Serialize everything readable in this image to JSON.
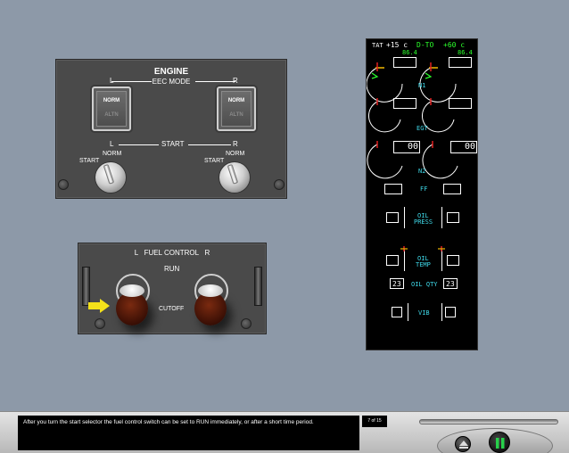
{
  "engine_panel": {
    "title": "ENGINE",
    "eec_mode_label": "EEC MODE",
    "left_label": "L",
    "right_label": "R",
    "eec_left": {
      "norm": "NORM",
      "altn": "ALTN"
    },
    "eec_right": {
      "norm": "NORM",
      "altn": "ALTN"
    },
    "start_label": "START",
    "start_left_label": "L",
    "start_right_label": "R",
    "knob_left": {
      "start": "START",
      "norm": "NORM"
    },
    "knob_right": {
      "start": "START",
      "norm": "NORM"
    }
  },
  "fuel_panel": {
    "title": "L   FUEL CONTROL   R",
    "run_label": "RUN",
    "cutoff_label": "CUTOFF",
    "arrow_color": "#f4e11a"
  },
  "eicas": {
    "tat_label": "TAT",
    "tat_value": "+15 c",
    "mode": "D-TO",
    "mode_temp": "+60 c",
    "n1_limit_left": "86.4",
    "n1_limit_right": "86.4",
    "n1_label": "N1",
    "egt_label": "EGT",
    "n2_left": "00",
    "n2_right": "00",
    "n2_label": "N2",
    "ff_label": "FF",
    "oil_press_label_1": "OIL",
    "oil_press_label_2": "PRESS",
    "oil_temp_label_1": "OIL",
    "oil_temp_label_2": "TEMP",
    "oil_qty_label": "OIL QTY",
    "oil_qty_left": "23",
    "oil_qty_right": "23",
    "vib_label": "VIB"
  },
  "bottom": {
    "message": "After you turn the start selector the fuel control switch can be set to RUN immediately, or after a short time period.",
    "page_indicator": "7 of 15",
    "progress_percent": 0
  }
}
